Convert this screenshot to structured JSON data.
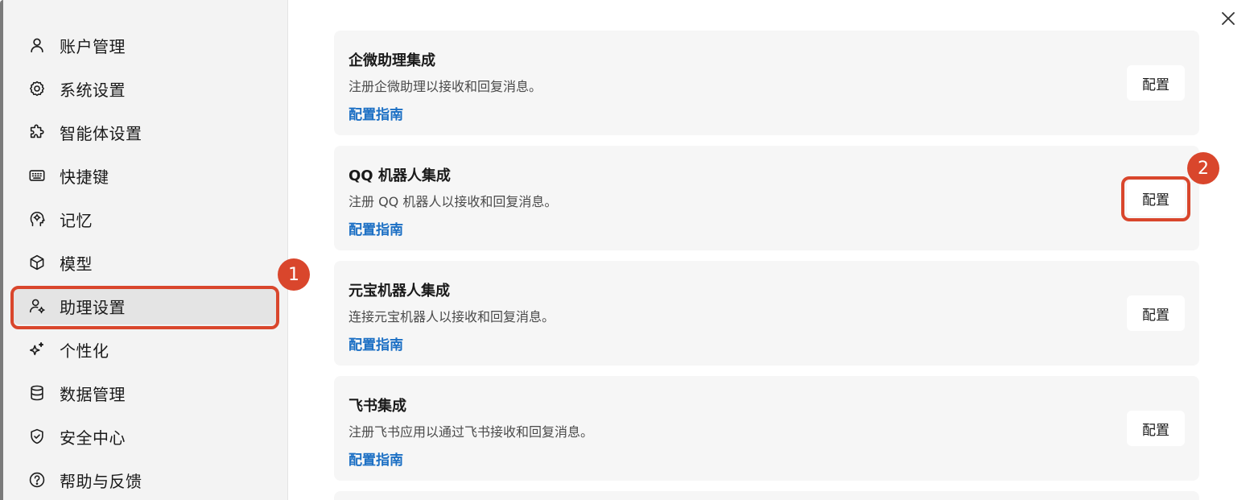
{
  "sidebar": {
    "items": [
      {
        "label": "账户管理",
        "icon": "user-icon"
      },
      {
        "label": "系统设置",
        "icon": "gear-icon"
      },
      {
        "label": "智能体设置",
        "icon": "puzzle-icon"
      },
      {
        "label": "快捷键",
        "icon": "keyboard-icon"
      },
      {
        "label": "记忆",
        "icon": "brain-head-icon"
      },
      {
        "label": "模型",
        "icon": "cube-icon"
      },
      {
        "label": "助理设置",
        "icon": "user-gear-icon",
        "active": true
      },
      {
        "label": "个性化",
        "icon": "sparkle-icon"
      },
      {
        "label": "数据管理",
        "icon": "database-icon"
      },
      {
        "label": "安全中心",
        "icon": "shield-icon"
      },
      {
        "label": "帮助与反馈",
        "icon": "help-icon"
      }
    ]
  },
  "annotations": {
    "badge_1": "1",
    "badge_2": "2",
    "color": "#d9462c"
  },
  "cards": [
    {
      "title": "企微助理集成",
      "desc": "注册企微助理以接收和回复消息。",
      "link": "配置指南",
      "button": "配置"
    },
    {
      "title": "QQ 机器人集成",
      "desc": "注册 QQ 机器人以接收和回复消息。",
      "link": "配置指南",
      "button": "配置"
    },
    {
      "title": "元宝机器人集成",
      "desc": "连接元宝机器人以接收和回复消息。",
      "link": "配置指南",
      "button": "配置"
    },
    {
      "title": "飞书集成",
      "desc": "注册飞书应用以通过飞书接收和回复消息。",
      "link": "配置指南",
      "button": "配置"
    }
  ],
  "colors": {
    "link": "#1b6fc4",
    "sidebar_bg": "#f3f3f3",
    "card_bg": "#f6f6f6"
  }
}
